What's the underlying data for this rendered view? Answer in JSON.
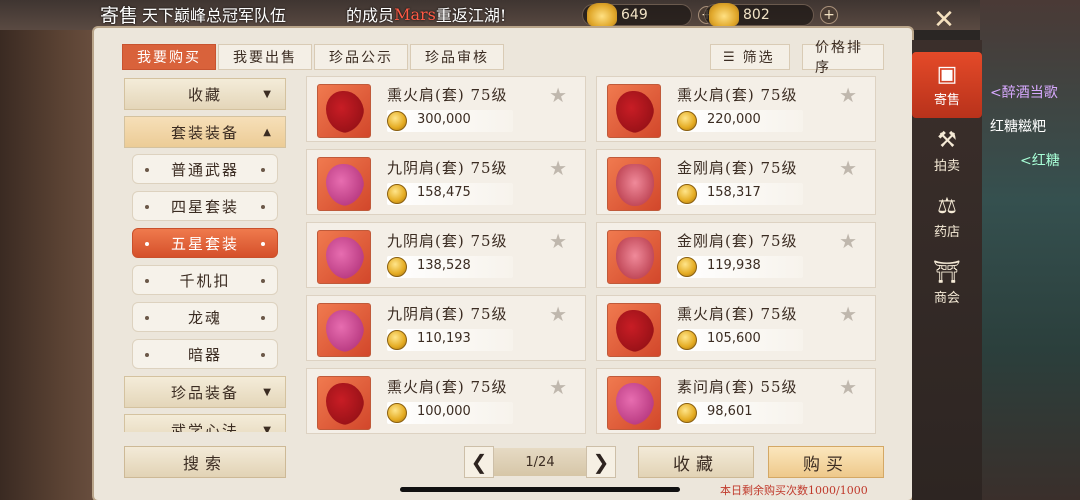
{
  "marquee": {
    "prefix": "寄售",
    "text_a": "天下",
    "text_b": "巅峰总冠军队伍",
    "text_c": "的成员",
    "player": "Mars",
    "text_d": "重返江湖!"
  },
  "currencies": [
    {
      "value": "649",
      "icon": "gold-ingot-icon"
    },
    {
      "value": "802",
      "icon": "silver-ingot-icon"
    }
  ],
  "tabs": [
    {
      "label": "我要购买",
      "active": true
    },
    {
      "label": "我要出售",
      "active": false
    },
    {
      "label": "珍品公示",
      "active": false
    },
    {
      "label": "珍品审核",
      "active": false
    }
  ],
  "toolbar": {
    "filter_label": "筛选",
    "sort_label": "价格排序"
  },
  "categories": {
    "favorites": "收藏",
    "set_equipment": "套装装备",
    "subs": [
      "普通武器",
      "四星套装",
      "五星套装",
      "千机扣",
      "龙魂",
      "暗器"
    ],
    "active_sub": "五星套装",
    "treasure_equipment": "珍品装备",
    "martial_arts": "武学心法"
  },
  "items": [
    {
      "name": "熏火肩(套) 75级",
      "price": "300,000",
      "icon": "red"
    },
    {
      "name": "熏火肩(套) 75级",
      "price": "220,000",
      "icon": "red"
    },
    {
      "name": "九阴肩(套) 75级",
      "price": "158,475",
      "icon": "pink"
    },
    {
      "name": "金刚肩(套) 75级",
      "price": "158,317",
      "icon": "mask"
    },
    {
      "name": "九阴肩(套) 75级",
      "price": "138,528",
      "icon": "pink"
    },
    {
      "name": "金刚肩(套) 75级",
      "price": "119,938",
      "icon": "mask"
    },
    {
      "name": "九阴肩(套) 75级",
      "price": "110,193",
      "icon": "pink"
    },
    {
      "name": "熏火肩(套) 75级",
      "price": "105,600",
      "icon": "red"
    },
    {
      "name": "熏火肩(套) 75级",
      "price": "100,000",
      "icon": "red"
    },
    {
      "name": "素问肩(套) 55级",
      "price": "98,601",
      "icon": "pink"
    }
  ],
  "bottom": {
    "search_label": "搜索",
    "page": "1/24",
    "favorite_label": "收藏",
    "buy_label": "购买",
    "remaining": "本日剩余购买次数1000/1000"
  },
  "side_menu": [
    {
      "label": "寄售",
      "icon": "consign-icon",
      "active": true
    },
    {
      "label": "拍卖",
      "icon": "gavel-icon",
      "active": false
    },
    {
      "label": "药店",
      "icon": "scale-icon",
      "active": false
    },
    {
      "label": "商会",
      "icon": "guild-icon",
      "active": false
    }
  ],
  "chat": {
    "line1": "<醉酒当歌",
    "line2": "红糖糍粑",
    "line3": "<红糖"
  }
}
